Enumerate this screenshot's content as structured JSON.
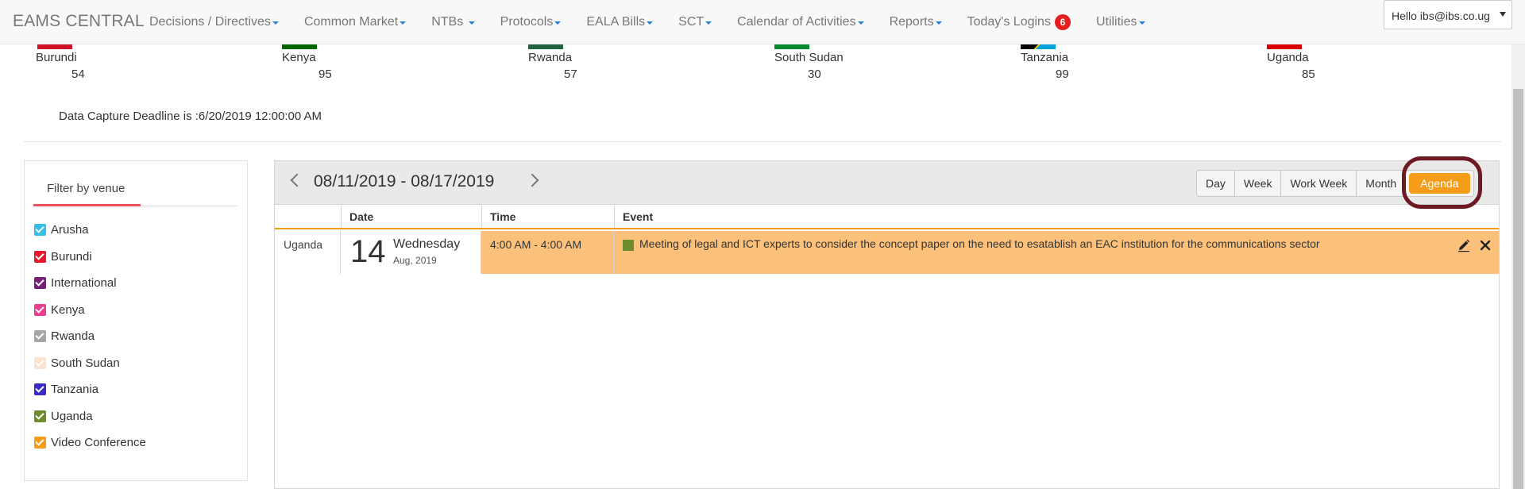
{
  "navbar": {
    "brand": "EAMS CENTRAL",
    "items": [
      {
        "label": "Decisions / Directives"
      },
      {
        "label": "Common Market"
      },
      {
        "label": "NTBs"
      },
      {
        "label": "Protocols"
      },
      {
        "label": "EALA Bills"
      },
      {
        "label": "SCT"
      },
      {
        "label": "Calendar of Activities"
      },
      {
        "label": "Reports"
      },
      {
        "label": "Today's Logins",
        "badge": "6"
      },
      {
        "label": "Utilities"
      }
    ],
    "user": "Hello ibs@ibs.co.ug"
  },
  "countries": [
    {
      "name": "Burundi",
      "value": "54",
      "flag_color": "#ce1126"
    },
    {
      "name": "Kenya",
      "value": "95",
      "flag_color": "#006600"
    },
    {
      "name": "Rwanda",
      "value": "57",
      "flag_color": "#20603d"
    },
    {
      "name": "South Sudan",
      "value": "30",
      "flag_color": "#078930"
    },
    {
      "name": "Tanzania",
      "value": "99",
      "flag_color": "#1eb53a"
    },
    {
      "name": "Uganda",
      "value": "85",
      "flag_color": "#d90000"
    }
  ],
  "deadline": "Data Capture Deadline is :6/20/2019 12:00:00 AM",
  "filter": {
    "title": "Filter by venue",
    "venues": [
      {
        "label": "Arusha",
        "color": "#35bfe8"
      },
      {
        "label": "Burundi",
        "color": "#e8192c"
      },
      {
        "label": "International",
        "color": "#7b1e7a"
      },
      {
        "label": "Kenya",
        "color": "#e93d8f"
      },
      {
        "label": "Rwanda",
        "color": "#a6a6a6"
      },
      {
        "label": "South Sudan",
        "color": "#fbe3cf"
      },
      {
        "label": "Tanzania",
        "color": "#3a2bc9"
      },
      {
        "label": "Uganda",
        "color": "#6e8b2e"
      },
      {
        "label": "Video Conference",
        "color": "#f59c1a"
      }
    ]
  },
  "scheduler": {
    "date_range": "08/11/2019 - 08/17/2019",
    "views": [
      "Day",
      "Week",
      "Work Week",
      "Month",
      "Agenda"
    ],
    "active_view": "Agenda",
    "columns": {
      "date": "Date",
      "time": "Time",
      "event": "Event"
    },
    "events": [
      {
        "venue": "Uganda",
        "day": "14",
        "weekday": "Wednesday",
        "month_year": "Aug, 2019",
        "time": "4:00 AM - 4:00 AM",
        "title": "Meeting of legal and ICT experts to consider the concept paper on the need to esatablish an EAC institution for the communications sector",
        "color": "#6e8b2e"
      }
    ]
  }
}
